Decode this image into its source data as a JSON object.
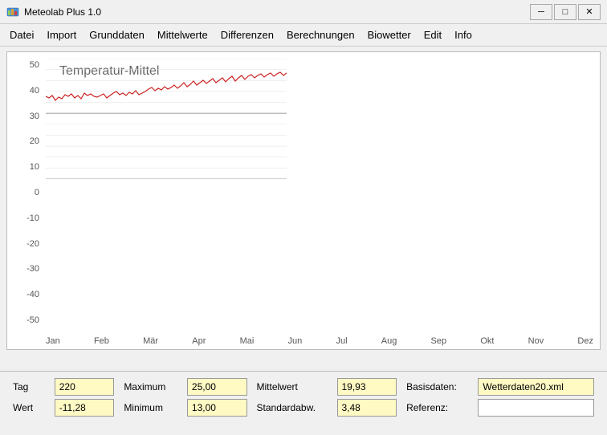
{
  "window": {
    "title": "Meteolab Plus 1.0",
    "icon": "📊"
  },
  "titlebar": {
    "minimize": "─",
    "maximize": "□",
    "close": "✕"
  },
  "menu": {
    "items": [
      "Datei",
      "Import",
      "Grunddaten",
      "Mittelwerte",
      "Differenzen",
      "Berechnungen",
      "Biowetter",
      "Edit",
      "Info"
    ]
  },
  "chart": {
    "title": "Temperatur-Mittel",
    "yAxis": [
      "50",
      "40",
      "30",
      "20",
      "10",
      "0",
      "-10",
      "-20",
      "-30",
      "-40",
      "-50"
    ],
    "xAxis": [
      "Jan",
      "Feb",
      "Mär",
      "Apr",
      "Mai",
      "Jun",
      "Jul",
      "Aug",
      "Sep",
      "Okt",
      "Nov",
      "Dez"
    ]
  },
  "fields": {
    "tag_label": "Tag",
    "tag_value": "220",
    "wert_label": "Wert",
    "wert_value": "-11,28",
    "maximum_label": "Maximum",
    "maximum_value": "25,00",
    "minimum_label": "Minimum",
    "minimum_value": "13,00",
    "mittelwert_label": "Mittelwert",
    "mittelwert_value": "19,93",
    "standardabw_label": "Standardabw.",
    "standardabw_value": "3,48",
    "basisdaten_label": "Basisdaten:",
    "basisdaten_value": "Wetterdaten20.xml",
    "referenz_label": "Referenz:",
    "referenz_value": ""
  }
}
